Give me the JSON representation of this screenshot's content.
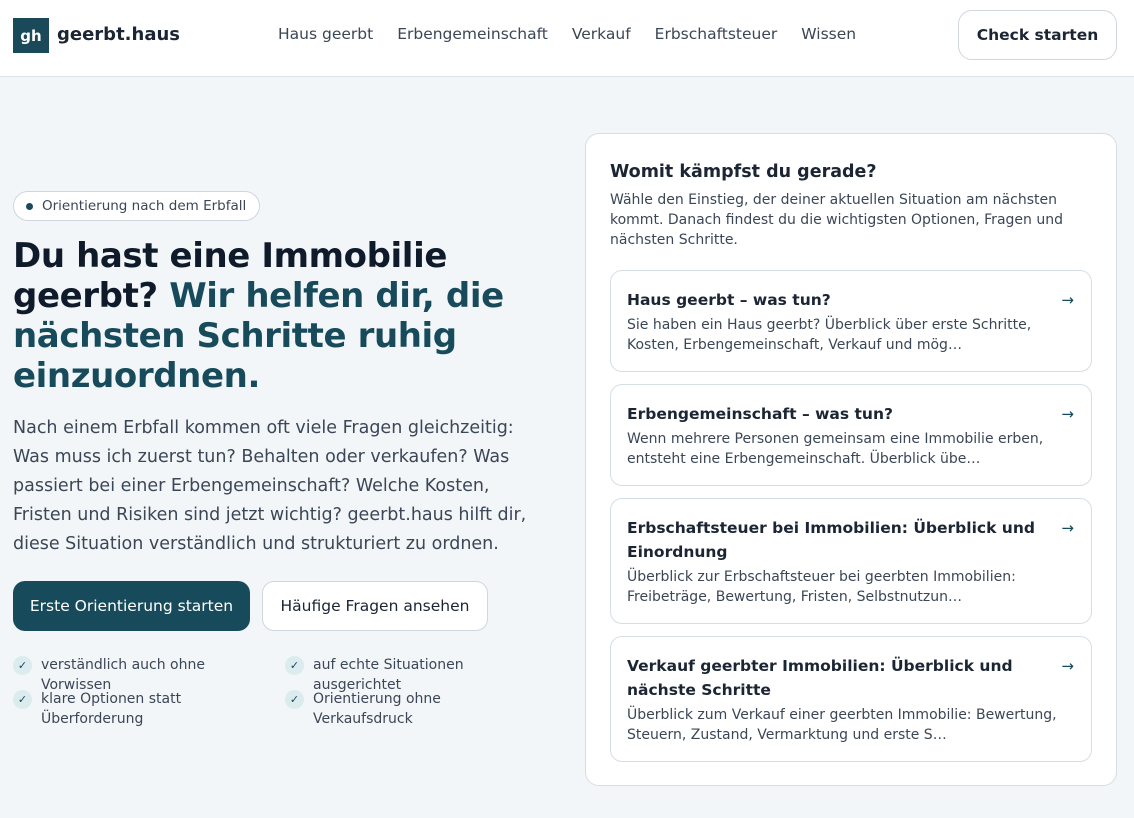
{
  "header": {
    "logo_mark": "gh",
    "logo_text": "geerbt.haus",
    "nav": [
      "Haus geerbt",
      "Erbengemeinschaft",
      "Verkauf",
      "Erbschaftsteuer",
      "Wissen"
    ],
    "cta": "Check starten"
  },
  "hero": {
    "badge": "Orientierung nach dem Erbfall",
    "title_main": "Du hast eine Immobilie geerbt?",
    "title_accent": "Wir helfen dir, die nächsten Schritte ruhig einzuordnen.",
    "text": "Nach einem Erbfall kommen oft viele Fragen gleichzeitig: Was muss ich zuerst tun? Behalten oder verkaufen? Was passiert bei einer Erbengemeinschaft? Welche Kosten, Fristen und Risiken sind jetzt wichtig? geerbt.haus hilft dir, diese Situation verständlich und strukturiert zu ordnen.",
    "primary_button": "Erste Orientierung starten",
    "secondary_button": "Häufige Fragen ansehen",
    "features": [
      "verständlich auch ohne Vorwissen",
      "auf echte Situationen ausgerichtet",
      "klare Optionen statt Überforderung",
      "Orientierung ohne Verkaufsdruck"
    ],
    "check_glyph": "✓"
  },
  "panel": {
    "title": "Womit kämpfst du gerade?",
    "subtitle": "Wähle den Einstieg, der deiner aktuellen Situation am nächsten kommt. Danach findest du die wichtigsten Optionen, Fragen und nächsten Schritte.",
    "arrow_glyph": "→",
    "cards": [
      {
        "title": "Haus geerbt – was tun?",
        "desc": "Sie haben ein Haus geerbt? Überblick über erste Schritte, Kosten, Erbengemeinschaft, Verkauf und mög…"
      },
      {
        "title": "Erbengemeinschaft – was tun?",
        "desc": "Wenn mehrere Personen gemeinsam eine Immobilie erben, entsteht eine Erbengemeinschaft. Überblick übe…"
      },
      {
        "title": "Erbschaftsteuer bei Immobilien: Überblick und Einordnung",
        "desc": "Überblick zur Erbschaftsteuer bei geerbten Immobilien: Freibeträge, Bewertung, Fristen, Selbstnutzun…"
      },
      {
        "title": "Verkauf geerbter Immobilien: Überblick und nächste Schritte",
        "desc": "Überblick zum Verkauf einer geerbten Immobilie: Bewertung, Steuern, Zustand, Vermarktung und erste S…"
      }
    ]
  }
}
